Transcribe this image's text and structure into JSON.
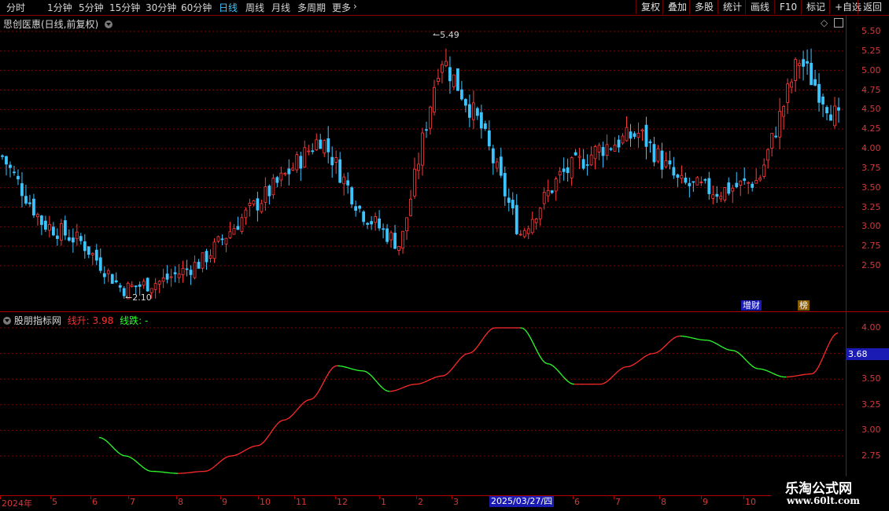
{
  "toolbar": {
    "periods": [
      "分时",
      "1分钟",
      "5分钟",
      "15分钟",
      "30分钟",
      "60分钟",
      "日线",
      "周线",
      "月线",
      "多周期",
      "更多"
    ],
    "active_period": "日线",
    "buttons": [
      "复权",
      "叠加",
      "多股",
      "统计",
      "画线",
      "F10",
      "标记",
      "+自选",
      "返回"
    ]
  },
  "main_chart": {
    "title": "思创医惠(日线,前复权)",
    "high_label": "5.49",
    "low_label": "2.10",
    "y_ticks": [
      "5.50",
      "5.25",
      "5.00",
      "4.75",
      "4.50",
      "4.25",
      "4.00",
      "3.75",
      "3.50",
      "3.25",
      "3.00",
      "2.75",
      "2.50"
    ],
    "badges": [
      "增财",
      "榜"
    ]
  },
  "indicator": {
    "title": "股朋指标网",
    "rise_label": "线升:",
    "rise_value": "3.98",
    "fall_label": "线跌:",
    "fall_value": "-",
    "current_value": "3.68",
    "y_ticks": [
      "4.00",
      "3.75",
      "3.50",
      "3.25",
      "3.00",
      "2.75"
    ]
  },
  "date_axis": {
    "ticks": [
      "2024年",
      "5",
      "6",
      "7",
      "8",
      "9",
      "10",
      "11",
      "12",
      "1",
      "2",
      "3",
      "6",
      "7",
      "8",
      "9",
      "10"
    ],
    "cursor_date": "2025/03/27/四"
  },
  "watermark": {
    "line1": "乐淘公式网",
    "line2": "www.60lt.com"
  },
  "colors": {
    "up": "#ff3b3b",
    "down": "#3cc4ff",
    "grid": "#8b0000",
    "rise_line": "#ff2a2a",
    "fall_line": "#2cff2c",
    "accent": "#1a1ab4"
  },
  "chart_data": [
    {
      "type": "candlestick",
      "title": "思创医惠(日线,前复权)",
      "ylim": [
        2.2,
        5.6
      ],
      "annotations": [
        {
          "text": "5.49",
          "value": 5.49
        },
        {
          "text": "2.10",
          "value": 2.1
        }
      ],
      "x": [
        "2024-04",
        "2024-05",
        "2024-06",
        "2024-07",
        "2024-08",
        "2024-09",
        "2024-10",
        "2024-11",
        "2024-12",
        "2025-01",
        "2025-02",
        "2025-03",
        "2025-04",
        "2025-05",
        "2025-06",
        "2025-07",
        "2025-08",
        "2025-09",
        "2025-10",
        "2025-11"
      ],
      "close_path": [
        3.9,
        3.05,
        2.8,
        2.2,
        2.3,
        2.55,
        3.1,
        3.6,
        4.15,
        3.2,
        2.75,
        5.2,
        4.3,
        2.9,
        3.65,
        4.0,
        4.2,
        3.55,
        3.45,
        3.6,
        5.15,
        4.35
      ]
    },
    {
      "type": "line",
      "title": "股朋指标网",
      "ylim": [
        2.55,
        4.1
      ],
      "values": [
        2.93,
        2.75,
        2.6,
        2.58,
        2.6,
        2.75,
        2.85,
        3.1,
        3.3,
        3.63,
        3.58,
        3.38,
        3.45,
        3.53,
        3.75,
        4.0,
        4.0,
        3.65,
        3.45,
        3.45,
        3.62,
        3.75,
        3.92,
        3.88,
        3.78,
        3.6,
        3.52,
        3.55,
        3.95
      ]
    }
  ]
}
